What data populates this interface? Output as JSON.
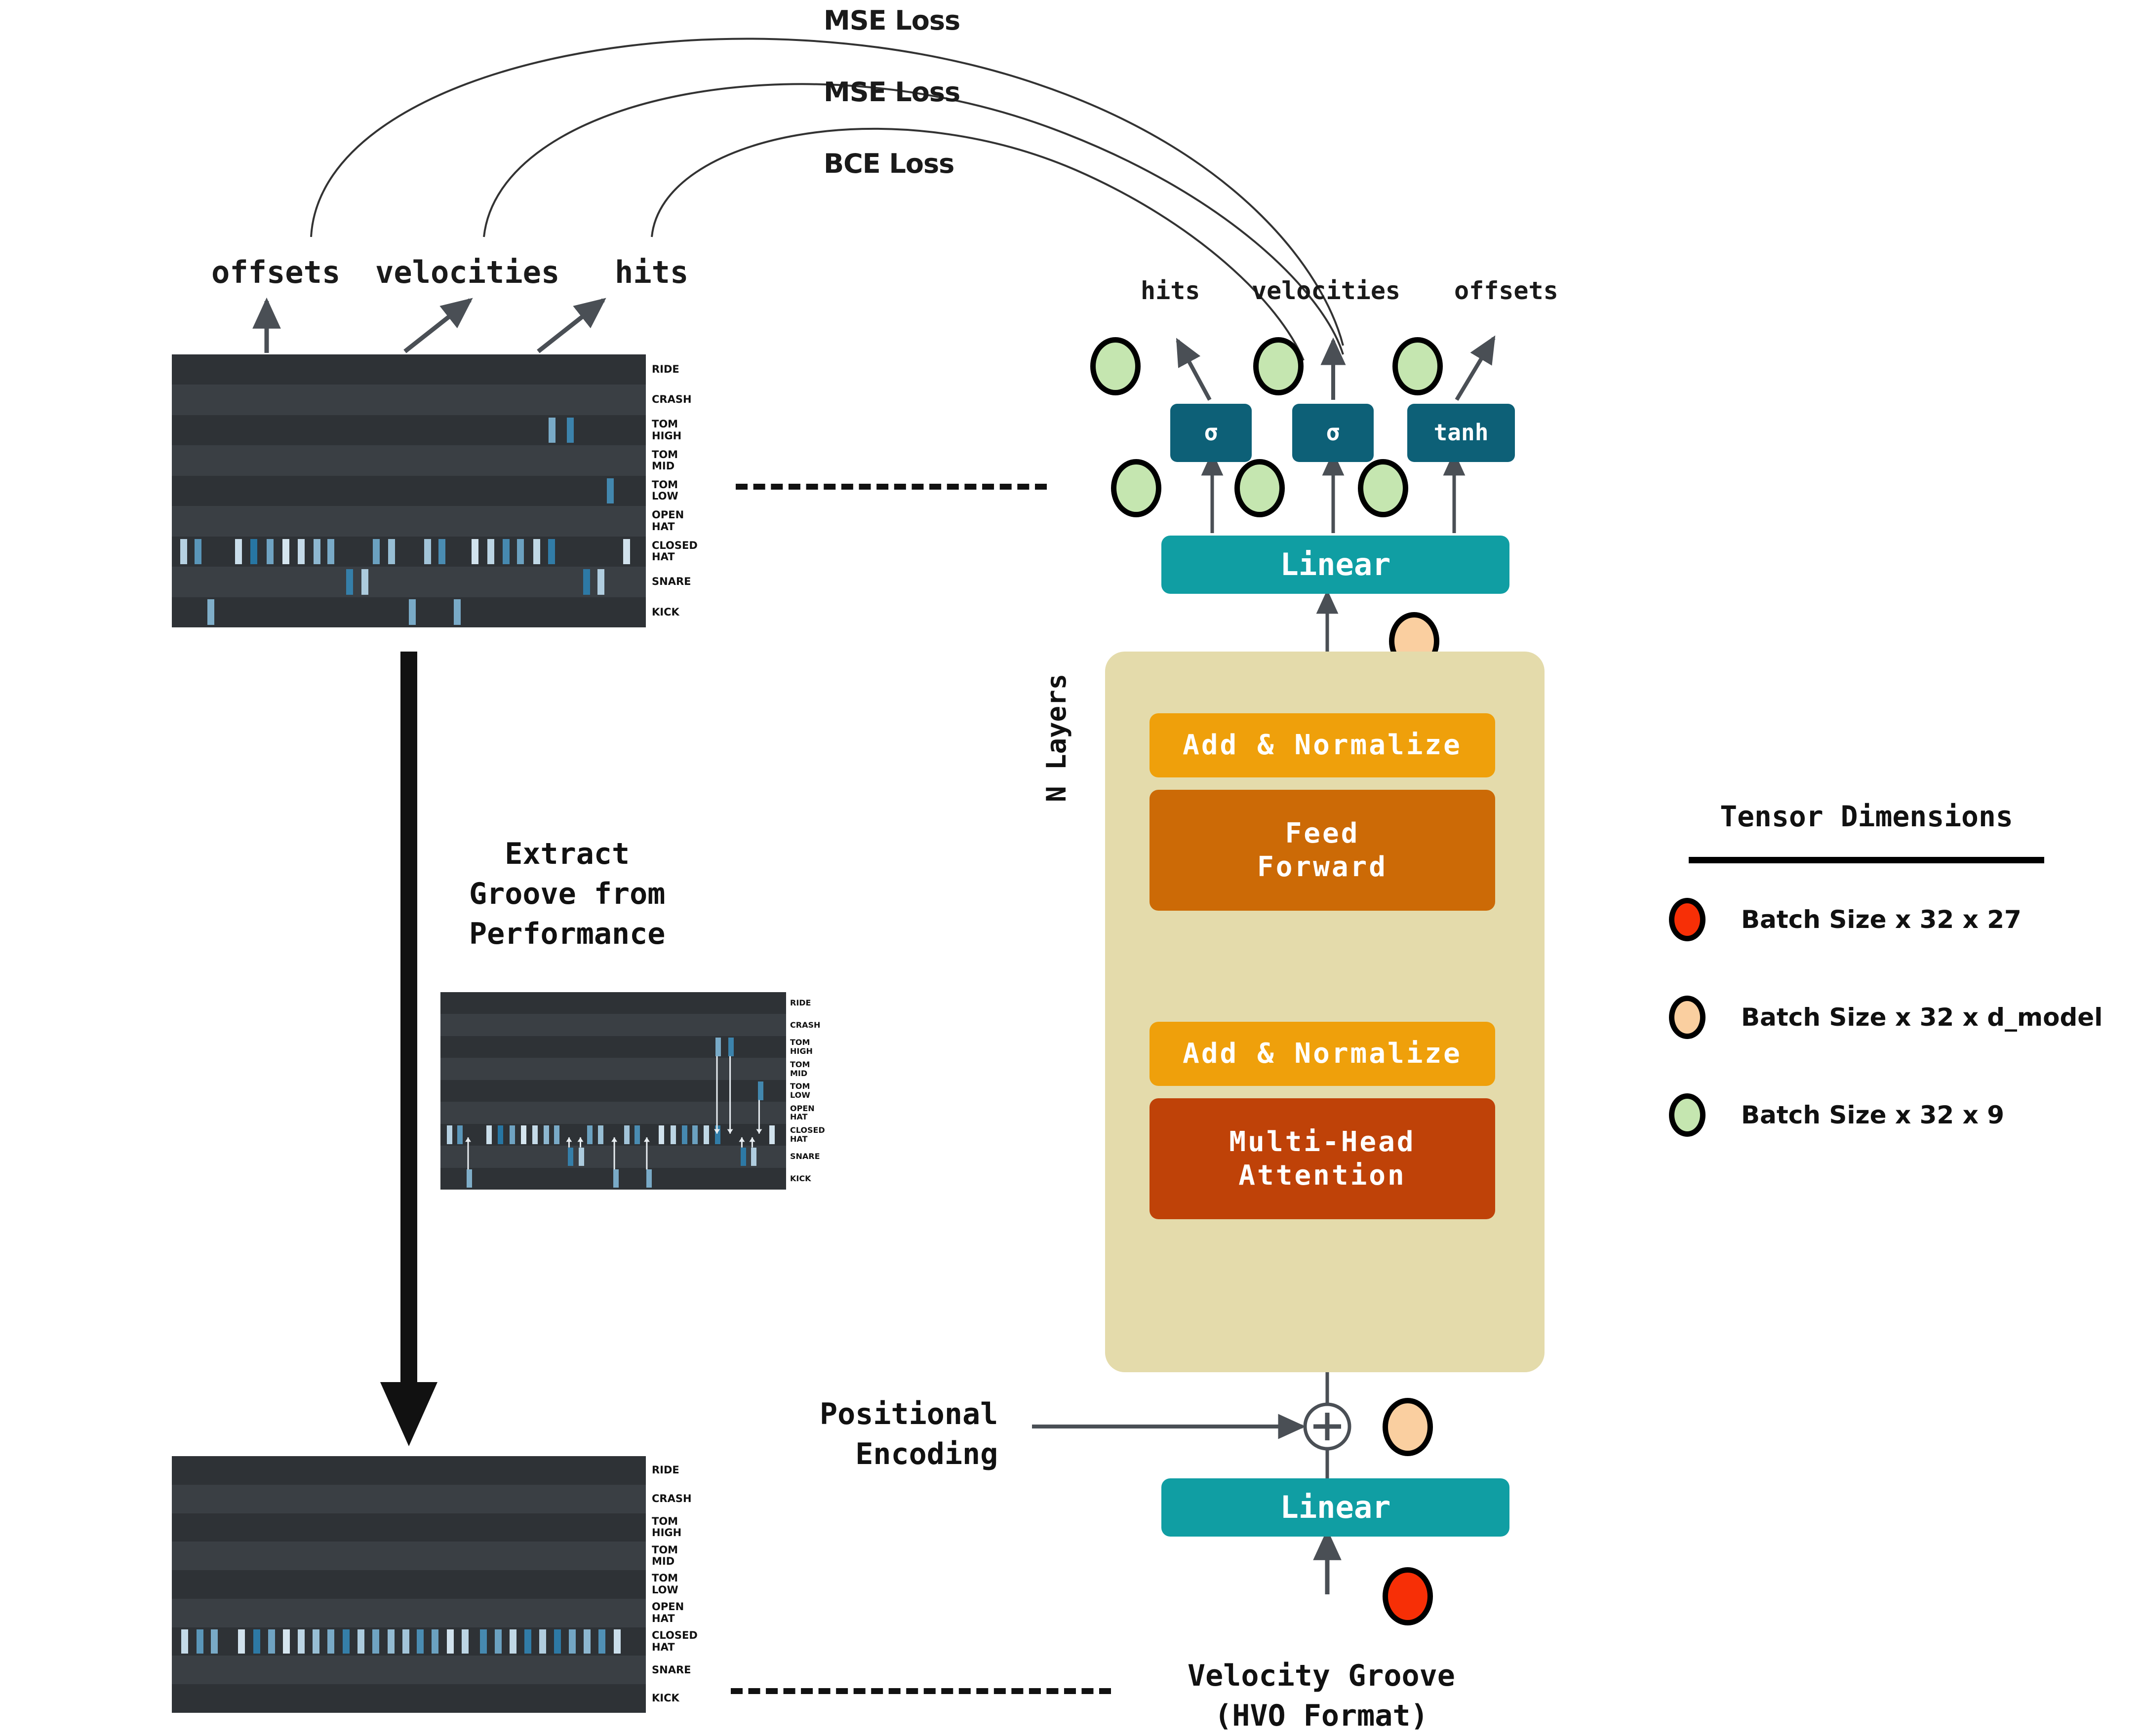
{
  "title": "Groove Transformer Architecture Diagram",
  "losses": [
    {
      "label": "MSE Loss"
    },
    {
      "label": "MSE Loss"
    },
    {
      "label": "BCE Loss"
    }
  ],
  "target_outputs": {
    "offsets": "offsets",
    "velocities": "velocities",
    "hits": "hits"
  },
  "model_outputs": {
    "hits": "hits",
    "velocities": "velocities",
    "offsets": "offsets"
  },
  "activations": {
    "hits": "σ",
    "velocities": "σ",
    "offsets": "tanh"
  },
  "blocks": {
    "linear_out": "Linear",
    "linear_in": "Linear",
    "add_norm_top": "Add & Normalize",
    "feed_forward": "Feed\nForward",
    "feed_forward_line1": "Feed",
    "feed_forward_line2": "Forward",
    "add_norm_bottom": "Add & Normalize",
    "attention_line1": "Multi-Head",
    "attention_line2": "Attention",
    "n_layers": "N Layers"
  },
  "inputs": {
    "positional_encoding_line1": "Positional",
    "positional_encoding_line2": "Encoding",
    "plus_symbol": "+",
    "velocity_groove_line1": "Velocity Groove",
    "velocity_groove_line2": "(HVO Format)"
  },
  "annotations": {
    "extract_line1": "Extract",
    "extract_line2": "Groove from",
    "extract_line3": "Performance"
  },
  "legend": {
    "title": "Tensor Dimensions",
    "rows": [
      {
        "color": "#F72F06",
        "label": "Batch Size x 32 x 27"
      },
      {
        "color": "#FACFA0",
        "label": "Batch Size x 32 x d_model"
      },
      {
        "color": "#C5E6B0",
        "label": "Batch Size x 32 x 9"
      }
    ]
  },
  "colors": {
    "teal": "#109EA3",
    "dark_teal": "#0D6077",
    "amber": "#EFA00B",
    "orange": "#CC6A06",
    "rust": "#BF4208",
    "panel_beige": "#E4DBAB",
    "roll_bg": "#2f3337",
    "note_blue": "#2f7fb0",
    "tensor_green": "#C5E6B0",
    "tensor_tan": "#FACFA0",
    "tensor_red": "#F72F06"
  },
  "drum_lanes": [
    "RIDE",
    "CRASH",
    "TOM\nHIGH",
    "TOM\nMID",
    "TOM\nLOW",
    "OPEN\nHAT",
    "CLOSED\nHAT",
    "SNARE",
    "KICK"
  ],
  "drum_lanes_split": [
    [
      "RIDE"
    ],
    [
      "CRASH"
    ],
    [
      "TOM",
      "HIGH"
    ],
    [
      "TOM",
      "MID"
    ],
    [
      "TOM",
      "LOW"
    ],
    [
      "OPEN",
      "HAT"
    ],
    [
      "CLOSED",
      "HAT"
    ],
    [
      "SNARE"
    ],
    [
      "KICK"
    ]
  ],
  "piano_rolls": {
    "top_left": {
      "name": "performance-piano-roll",
      "notes": [
        {
          "lane": 2,
          "x": 0.795,
          "v": 0.55
        },
        {
          "lane": 2,
          "x": 0.833,
          "v": 0.85
        },
        {
          "lane": 4,
          "x": 0.918,
          "v": 0.82
        },
        {
          "lane": 6,
          "x": 0.018,
          "v": 0.25
        },
        {
          "lane": 6,
          "x": 0.048,
          "v": 0.7
        },
        {
          "lane": 6,
          "x": 0.133,
          "v": 0.15
        },
        {
          "lane": 6,
          "x": 0.166,
          "v": 0.95
        },
        {
          "lane": 6,
          "x": 0.2,
          "v": 0.6
        },
        {
          "lane": 6,
          "x": 0.233,
          "v": 0.1
        },
        {
          "lane": 6,
          "x": 0.266,
          "v": 0.18
        },
        {
          "lane": 6,
          "x": 0.299,
          "v": 0.45
        },
        {
          "lane": 6,
          "x": 0.328,
          "v": 0.55
        },
        {
          "lane": 6,
          "x": 0.424,
          "v": 0.62
        },
        {
          "lane": 6,
          "x": 0.456,
          "v": 0.4
        },
        {
          "lane": 6,
          "x": 0.532,
          "v": 0.35
        },
        {
          "lane": 6,
          "x": 0.562,
          "v": 0.78
        },
        {
          "lane": 6,
          "x": 0.632,
          "v": 0.12
        },
        {
          "lane": 6,
          "x": 0.666,
          "v": 0.22
        },
        {
          "lane": 6,
          "x": 0.698,
          "v": 0.8
        },
        {
          "lane": 6,
          "x": 0.728,
          "v": 0.62
        },
        {
          "lane": 6,
          "x": 0.762,
          "v": 0.2
        },
        {
          "lane": 6,
          "x": 0.794,
          "v": 0.9
        },
        {
          "lane": 6,
          "x": 0.952,
          "v": 0.12
        },
        {
          "lane": 7,
          "x": 0.368,
          "v": 0.88
        },
        {
          "lane": 7,
          "x": 0.4,
          "v": 0.3
        },
        {
          "lane": 7,
          "x": 0.868,
          "v": 0.92
        },
        {
          "lane": 7,
          "x": 0.898,
          "v": 0.28
        },
        {
          "lane": 8,
          "x": 0.075,
          "v": 0.52
        },
        {
          "lane": 8,
          "x": 0.5,
          "v": 0.55
        },
        {
          "lane": 8,
          "x": 0.595,
          "v": 0.55
        }
      ]
    },
    "middle": {
      "name": "groove-extraction-piano-roll",
      "notes": [
        {
          "lane": 2,
          "x": 0.795,
          "v": 0.55
        },
        {
          "lane": 2,
          "x": 0.833,
          "v": 0.85
        },
        {
          "lane": 4,
          "x": 0.918,
          "v": 0.82
        },
        {
          "lane": 6,
          "x": 0.018,
          "v": 0.25
        },
        {
          "lane": 6,
          "x": 0.048,
          "v": 0.7
        },
        {
          "lane": 6,
          "x": 0.133,
          "v": 0.15
        },
        {
          "lane": 6,
          "x": 0.166,
          "v": 0.95
        },
        {
          "lane": 6,
          "x": 0.2,
          "v": 0.6
        },
        {
          "lane": 6,
          "x": 0.233,
          "v": 0.1
        },
        {
          "lane": 6,
          "x": 0.266,
          "v": 0.18
        },
        {
          "lane": 6,
          "x": 0.299,
          "v": 0.45
        },
        {
          "lane": 6,
          "x": 0.328,
          "v": 0.55
        },
        {
          "lane": 6,
          "x": 0.424,
          "v": 0.62
        },
        {
          "lane": 6,
          "x": 0.456,
          "v": 0.4
        },
        {
          "lane": 6,
          "x": 0.532,
          "v": 0.35
        },
        {
          "lane": 6,
          "x": 0.562,
          "v": 0.78
        },
        {
          "lane": 6,
          "x": 0.632,
          "v": 0.12
        },
        {
          "lane": 6,
          "x": 0.666,
          "v": 0.22
        },
        {
          "lane": 6,
          "x": 0.698,
          "v": 0.8
        },
        {
          "lane": 6,
          "x": 0.728,
          "v": 0.62
        },
        {
          "lane": 6,
          "x": 0.762,
          "v": 0.2
        },
        {
          "lane": 6,
          "x": 0.794,
          "v": 0.9
        },
        {
          "lane": 6,
          "x": 0.952,
          "v": 0.12
        },
        {
          "lane": 7,
          "x": 0.368,
          "v": 0.88
        },
        {
          "lane": 7,
          "x": 0.4,
          "v": 0.3
        },
        {
          "lane": 7,
          "x": 0.868,
          "v": 0.92
        },
        {
          "lane": 7,
          "x": 0.898,
          "v": 0.28
        },
        {
          "lane": 8,
          "x": 0.075,
          "v": 0.52
        },
        {
          "lane": 8,
          "x": 0.5,
          "v": 0.55
        },
        {
          "lane": 8,
          "x": 0.595,
          "v": 0.55
        }
      ],
      "collapse_arrows": [
        {
          "x": 0.08,
          "from_lane": 8,
          "to_lane": 6
        },
        {
          "x": 0.372,
          "from_lane": 7,
          "to_lane": 6
        },
        {
          "x": 0.405,
          "from_lane": 7,
          "to_lane": 6
        },
        {
          "x": 0.503,
          "from_lane": 8,
          "to_lane": 6
        },
        {
          "x": 0.597,
          "from_lane": 8,
          "to_lane": 6
        },
        {
          "x": 0.8,
          "from_lane": 2,
          "to_lane": 6
        },
        {
          "x": 0.838,
          "from_lane": 2,
          "to_lane": 6
        },
        {
          "x": 0.922,
          "from_lane": 4,
          "to_lane": 6
        },
        {
          "x": 0.872,
          "from_lane": 7,
          "to_lane": 6
        },
        {
          "x": 0.902,
          "from_lane": 7,
          "to_lane": 6
        }
      ]
    },
    "bottom_left": {
      "name": "velocity-groove-piano-roll",
      "notes": [
        {
          "lane": 6,
          "x": 0.02,
          "v": 0.18
        },
        {
          "lane": 6,
          "x": 0.052,
          "v": 0.7
        },
        {
          "lane": 6,
          "x": 0.082,
          "v": 0.55
        },
        {
          "lane": 6,
          "x": 0.14,
          "v": 0.12
        },
        {
          "lane": 6,
          "x": 0.172,
          "v": 0.92
        },
        {
          "lane": 6,
          "x": 0.203,
          "v": 0.6
        },
        {
          "lane": 6,
          "x": 0.234,
          "v": 0.1
        },
        {
          "lane": 6,
          "x": 0.266,
          "v": 0.22
        },
        {
          "lane": 6,
          "x": 0.297,
          "v": 0.4
        },
        {
          "lane": 6,
          "x": 0.328,
          "v": 0.55
        },
        {
          "lane": 6,
          "x": 0.36,
          "v": 0.88
        },
        {
          "lane": 6,
          "x": 0.392,
          "v": 0.3
        },
        {
          "lane": 6,
          "x": 0.423,
          "v": 0.6
        },
        {
          "lane": 6,
          "x": 0.455,
          "v": 0.42
        },
        {
          "lane": 6,
          "x": 0.486,
          "v": 0.35
        },
        {
          "lane": 6,
          "x": 0.517,
          "v": 0.78
        },
        {
          "lane": 6,
          "x": 0.548,
          "v": 0.62
        },
        {
          "lane": 6,
          "x": 0.58,
          "v": 0.12
        },
        {
          "lane": 6,
          "x": 0.611,
          "v": 0.22
        },
        {
          "lane": 6,
          "x": 0.65,
          "v": 0.8
        },
        {
          "lane": 6,
          "x": 0.681,
          "v": 0.62
        },
        {
          "lane": 6,
          "x": 0.712,
          "v": 0.2
        },
        {
          "lane": 6,
          "x": 0.744,
          "v": 0.9
        },
        {
          "lane": 6,
          "x": 0.775,
          "v": 0.28
        },
        {
          "lane": 6,
          "x": 0.806,
          "v": 0.92
        },
        {
          "lane": 6,
          "x": 0.838,
          "v": 0.58
        },
        {
          "lane": 6,
          "x": 0.869,
          "v": 0.45
        },
        {
          "lane": 6,
          "x": 0.9,
          "v": 0.75
        },
        {
          "lane": 6,
          "x": 0.932,
          "v": 0.15
        }
      ]
    }
  }
}
